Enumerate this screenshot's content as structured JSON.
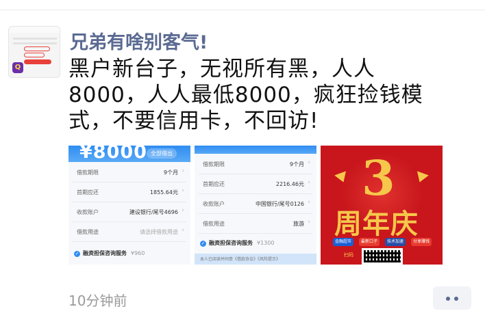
{
  "post": {
    "username": "兄弟有啥别客气!",
    "text": "黑户新台子，无视所有黑，人人8000，人人最低8000，疯狂捡钱模式，不要信用卡，不回访!",
    "timestamp": "10分钟前"
  },
  "avatar": {
    "logo_glyph": "Q"
  },
  "images": {
    "loan_a": {
      "amount": "¥8000",
      "action": "全部借出",
      "rows": [
        {
          "label": "借款期限",
          "value": "9个月"
        },
        {
          "label": "首期应还",
          "value": "1855.64元"
        },
        {
          "label": "收款账户",
          "value": "建设银行/尾号4696"
        },
        {
          "label": "借款用途",
          "value": "请选择借款用途"
        }
      ],
      "service": "融资担保咨询服务",
      "service_price": "¥960"
    },
    "loan_b": {
      "rows": [
        {
          "label": "借款期限",
          "value": "9个月"
        },
        {
          "label": "首期应还",
          "value": "2216.46元"
        },
        {
          "label": "收款账户",
          "value": "中国银行/尾号0126"
        },
        {
          "label": "借款用途",
          "value": "旅游"
        }
      ],
      "service": "融资担保咨询服务",
      "service_price": "¥1300",
      "fine_print": "本人已阅读并同意《借款协议》《风险提示》"
    },
    "poster": {
      "number": "3",
      "title": "周年庆",
      "tags": [
        "金融超市",
        "最新口子",
        "技术加速",
        "分享赚钱"
      ],
      "scan_text": "扫码"
    }
  },
  "colors": {
    "username": "#5a6a92",
    "loan_blue": "#2f8df2",
    "poster_red": "#c8161c",
    "poster_gold": "#f6c74a"
  }
}
